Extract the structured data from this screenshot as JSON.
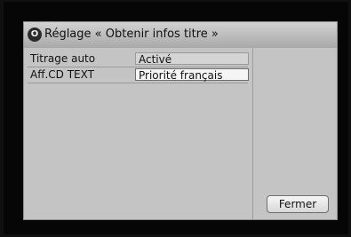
{
  "dialog": {
    "title": "Réglage « Obtenir infos titre »",
    "title_icon": "o-circle-icon"
  },
  "settings": [
    {
      "label": "Titrage auto",
      "value": "Activé"
    },
    {
      "label": "Aff.CD TEXT",
      "value": "Priorité français"
    }
  ],
  "buttons": {
    "close_label": "Fermer"
  },
  "colors": {
    "dialog_background": "#c9c9c9",
    "selected_value_background": "#f5f5f5",
    "screen_background": "#060606"
  }
}
